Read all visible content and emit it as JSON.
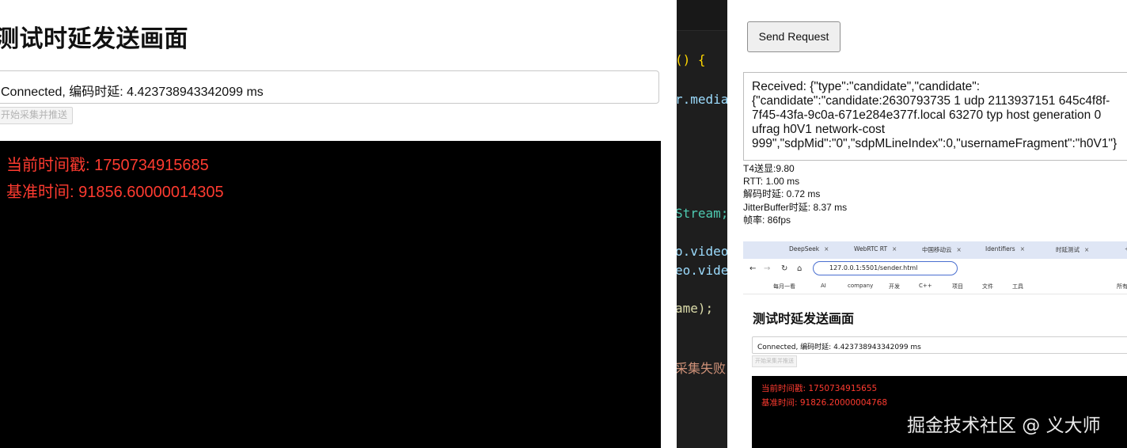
{
  "left": {
    "title": "测试时延发送画面",
    "status": "Connected, 编码时延: 4.423738943342099 ms",
    "start_button": "开始采集并推送",
    "timestamp": "当前时间戳: 1750734915685",
    "base_time": "基准时间: 91856.60000014305"
  },
  "code": {
    "lines": [
      "() {",
      "r.media",
      "Stream;",
      "o.video",
      "eo.vide",
      "ame);",
      "采集失败"
    ]
  },
  "right": {
    "send_button": "Send Request",
    "received": "Received: {\"type\":\"candidate\",\"candidate\":\n{\"candidate\":\"candidate:2630793735 1 udp 2113937151 645c4f8f-\n7f45-43fa-9c0a-671e284e377f.local 63270 typ host generation 0\nufrag h0V1 network-cost\n999\",\"sdpMid\":\"0\",\"sdpMLineIndex\":0,\"usernameFragment\":\"h0V1\"}",
    "stats": {
      "t4": "T4送显:9.80",
      "rtt": "RTT: 1.00 ms",
      "decode": "解码时延: 0.72 ms",
      "jitter": "JitterBuffer时延: 8.37 ms",
      "fps": "帧率: 86fps"
    }
  },
  "screenshot": {
    "tabs": [
      "DeepSeek",
      "WebRTC RT",
      "中国移动云",
      "Identifiers",
      "时延测试"
    ],
    "address": "127.0.0.1:5501/sender.html",
    "bookmarks": [
      "每月一看",
      "AI",
      "company",
      "开发",
      "C++",
      "项目",
      "文件",
      "工具",
      "所有书"
    ],
    "title": "测试时延发送画面",
    "status": "Connected, 编码时延: 4.423738943342099 ms",
    "start_button": "开始采集并推送",
    "timestamp": "当前时间戳: 1750734915655",
    "base_time": "基准时间: 91826.20000004768"
  },
  "watermark": "掘金技术社区 @ 义大师",
  "colors": {
    "overlay_red": "#ff3b30",
    "editor_bg": "#1e1e1e",
    "video_bg": "#000000"
  }
}
